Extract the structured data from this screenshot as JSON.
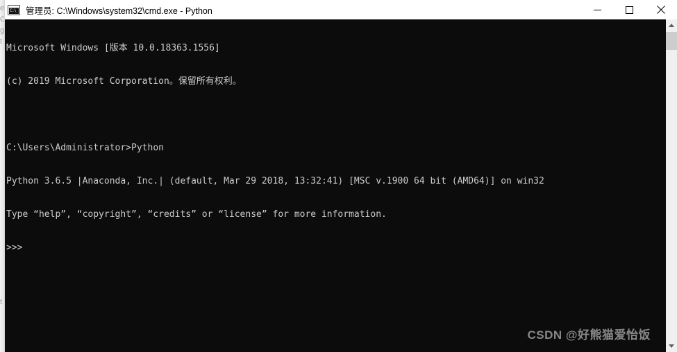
{
  "window": {
    "title": "管理员: C:\\Windows\\system32\\cmd.exe - Python",
    "icon": "cmd-console-icon",
    "icon_text": "C:\\",
    "background_color": "#0c0c0c",
    "foreground_color": "#cccccc",
    "titlebar_color": "#ffffff"
  },
  "controls": {
    "minimize": "minimize-icon",
    "maximize": "maximize-icon",
    "close": "close-icon",
    "minimize_label": "最小化",
    "maximize_label": "最大化",
    "close_label": "关闭"
  },
  "console": {
    "lines": [
      "Microsoft Windows [版本 10.0.18363.1556]",
      "(c) 2019 Microsoft Corporation。保留所有权利。",
      "",
      "C:\\Users\\Administrator>Python",
      "Python 3.6.5 |Anaconda, Inc.| (default, Mar 29 2018, 13:32:41) [MSC v.1900 64 bit (AMD64)] on win32",
      "Type “help”, “copyright”, “credits” or “license” for more information.",
      ">>>"
    ]
  },
  "scrollbar": {
    "up_arrow": "scroll-up-arrow-icon",
    "down_arrow": "scroll-down-arrow-icon",
    "thumb_position_percent": 0,
    "track_color": "#f0f0f0",
    "thumb_color": "#cdcdcd"
  },
  "watermark": {
    "text": "CSDN @好熊猫爱怡饭"
  },
  "background_ghost": {
    "lines": [
      "e",
      "C",
      "g",
      "t",
      "t"
    ]
  }
}
